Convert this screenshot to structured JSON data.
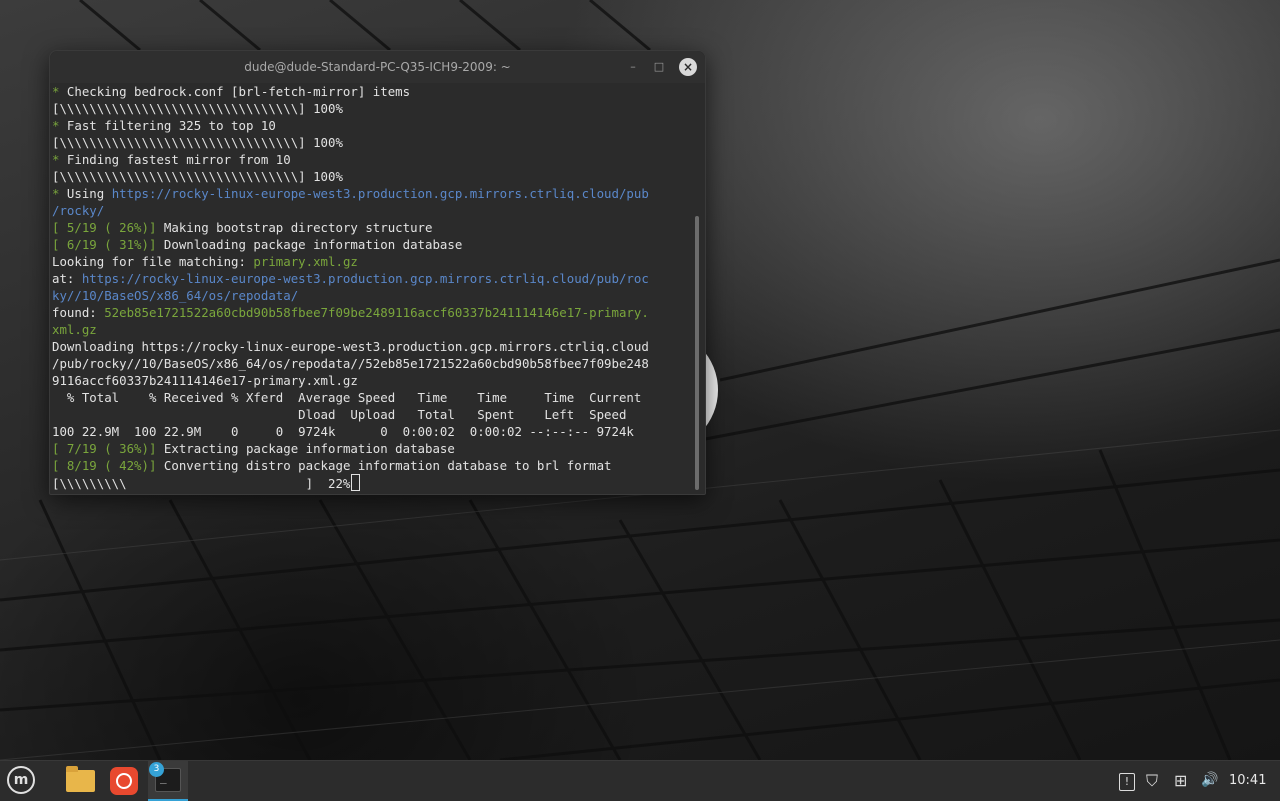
{
  "window": {
    "title": "dude@dude-Standard-PC-Q35-ICH9-2009: ~",
    "min_glyph": "–",
    "max_glyph": "□",
    "close_glyph": "×"
  },
  "terminal": {
    "lines": [
      [
        {
          "t": "* ",
          "c": "green"
        },
        {
          "t": "Checking bedrock.conf [brl-fetch-mirror] items"
        }
      ],
      [
        {
          "t": "[\\\\\\\\\\\\\\\\\\\\\\\\\\\\\\\\\\\\\\\\\\\\\\\\\\\\\\\\\\\\\\\\] 100%"
        }
      ],
      [
        {
          "t": "* ",
          "c": "green"
        },
        {
          "t": "Fast filtering 325 to top 10"
        }
      ],
      [
        {
          "t": "[\\\\\\\\\\\\\\\\\\\\\\\\\\\\\\\\\\\\\\\\\\\\\\\\\\\\\\\\\\\\\\\\] 100%"
        }
      ],
      [
        {
          "t": "* ",
          "c": "green"
        },
        {
          "t": "Finding fastest mirror from 10"
        }
      ],
      [
        {
          "t": "[\\\\\\\\\\\\\\\\\\\\\\\\\\\\\\\\\\\\\\\\\\\\\\\\\\\\\\\\\\\\\\\\] 100%"
        }
      ],
      [
        {
          "t": "* ",
          "c": "green"
        },
        {
          "t": "Using "
        },
        {
          "t": "https://rocky-linux-europe-west3.production.gcp.mirrors.ctrliq.cloud/pub",
          "c": "link"
        }
      ],
      [
        {
          "t": "/rocky/",
          "c": "link"
        }
      ],
      [
        {
          "t": "[ 5/19 ( 26%)] ",
          "c": "green"
        },
        {
          "t": "Making bootstrap directory structure"
        }
      ],
      [
        {
          "t": "[ 6/19 ( 31%)] ",
          "c": "green"
        },
        {
          "t": "Downloading package information database"
        }
      ],
      [
        {
          "t": "Looking for file matching: "
        },
        {
          "t": "primary.xml.gz",
          "c": "green"
        }
      ],
      [
        {
          "t": "at: "
        },
        {
          "t": "https://rocky-linux-europe-west3.production.gcp.mirrors.ctrliq.cloud/pub/roc",
          "c": "link"
        }
      ],
      [
        {
          "t": "ky//10/BaseOS/x86_64/os/repodata/",
          "c": "link"
        }
      ],
      [
        {
          "t": "found: "
        },
        {
          "t": "52eb85e1721522a60cbd90b58fbee7f09be2489116accf60337b241114146e17-primary.",
          "c": "green"
        }
      ],
      [
        {
          "t": "xml.gz",
          "c": "green"
        }
      ],
      [
        {
          "t": "Downloading https://rocky-linux-europe-west3.production.gcp.mirrors.ctrliq.cloud"
        }
      ],
      [
        {
          "t": "/pub/rocky//10/BaseOS/x86_64/os/repodata//52eb85e1721522a60cbd90b58fbee7f09be248"
        }
      ],
      [
        {
          "t": "9116accf60337b241114146e17-primary.xml.gz"
        }
      ],
      [
        {
          "t": "  % Total    % Received % Xferd  Average Speed   Time    Time     Time  Current"
        }
      ],
      [
        {
          "t": "                                 Dload  Upload   Total   Spent    Left  Speed"
        }
      ],
      [
        {
          "t": "100 22.9M  100 22.9M    0     0  9724k      0  0:00:02  0:00:02 --:--:-- 9724k"
        }
      ],
      [
        {
          "t": "[ 7/19 ( 36%)] ",
          "c": "green"
        },
        {
          "t": "Extracting package information database"
        }
      ],
      [
        {
          "t": "[ 8/19 ( 42%)] ",
          "c": "green"
        },
        {
          "t": "Converting distro package information database to brl format"
        }
      ],
      [
        {
          "t": "[\\\\\\\\\\\\\\\\\\                        ]  22%"
        }
      ]
    ]
  },
  "taskbar": {
    "menu_glyph": "m",
    "terminal_badge": "3",
    "terminal_glyph": "_",
    "tray": {
      "notes_glyph": "!",
      "shield_glyph": "⛉",
      "network_glyph": "⊞",
      "volume_glyph": "🔊"
    },
    "clock": "10:41"
  },
  "colors": {
    "green": "#7aa63c",
    "link": "#5a87c9",
    "accent": "#35a2d6"
  }
}
